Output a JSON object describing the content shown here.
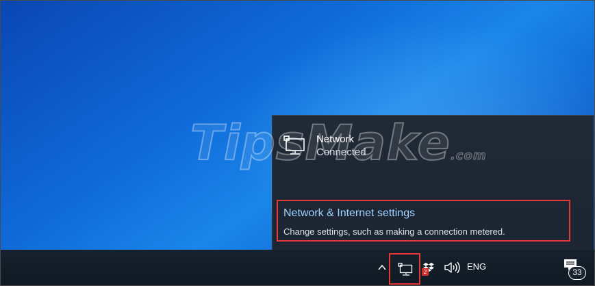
{
  "watermark": {
    "text": "TipsMake",
    "suffix": ".com"
  },
  "flyout": {
    "network": {
      "name": "Network",
      "status": "Connected",
      "icon": "wired-network-icon"
    },
    "settings": {
      "title": "Network & Internet settings",
      "description": "Change settings, such as making a connection metered."
    },
    "highlight_color": "#e53935"
  },
  "taskbar": {
    "tray": {
      "chevron_icon": "chevron-up-icon",
      "network_icon": "wired-network-icon",
      "dropbox_icon": "dropbox-icon",
      "dropbox_badge": "2",
      "volume_icon": "speaker-icon",
      "language": "ENG",
      "action_center_icon": "notification-icon",
      "notification_count": "33"
    }
  }
}
